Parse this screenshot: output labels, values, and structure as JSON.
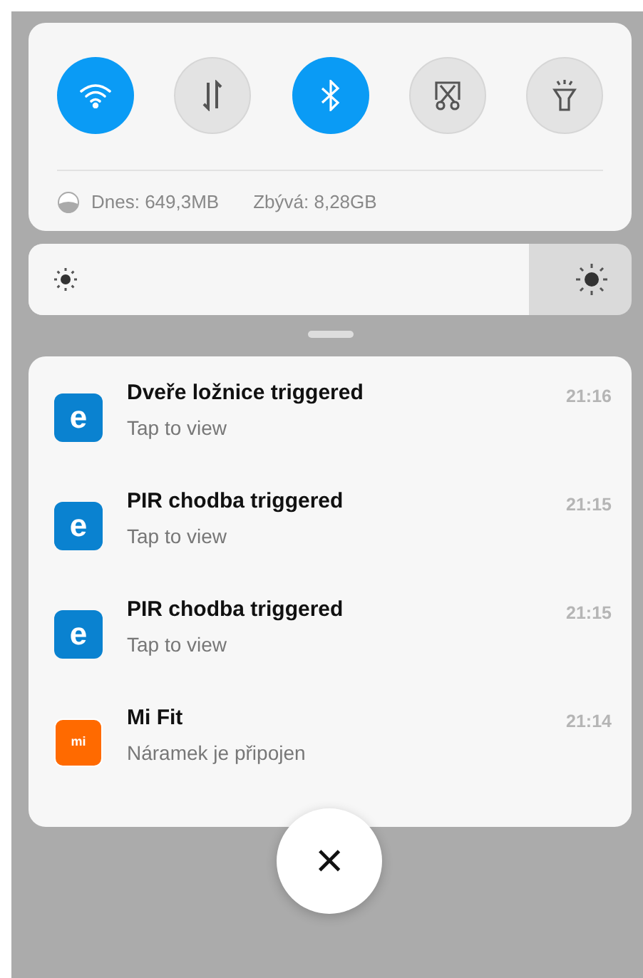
{
  "toggles": [
    {
      "kind": "wifi",
      "on": true
    },
    {
      "kind": "data",
      "on": false
    },
    {
      "kind": "bluetooth",
      "on": true
    },
    {
      "kind": "screenshot",
      "on": false
    },
    {
      "kind": "flashlight",
      "on": false
    }
  ],
  "data_usage": {
    "today": "Dnes: 649,3MB",
    "remaining": "Zbývá: 8,28GB"
  },
  "brightness": {
    "level": 0.83
  },
  "notifications": [
    {
      "app": "e",
      "kind": "ewelink",
      "title": "Dveře ložnice triggered",
      "text": "Tap to view",
      "time": "21:16"
    },
    {
      "app": "e",
      "kind": "ewelink",
      "title": "PIR chodba triggered",
      "text": "Tap to view",
      "time": "21:15"
    },
    {
      "app": "e",
      "kind": "ewelink",
      "title": "PIR chodba triggered",
      "text": "Tap to view",
      "time": "21:15"
    },
    {
      "app": "mi",
      "kind": "mifit",
      "title": "Mi Fit",
      "text": "Náramek je připojen",
      "time": "21:14"
    }
  ],
  "close_button": "×"
}
